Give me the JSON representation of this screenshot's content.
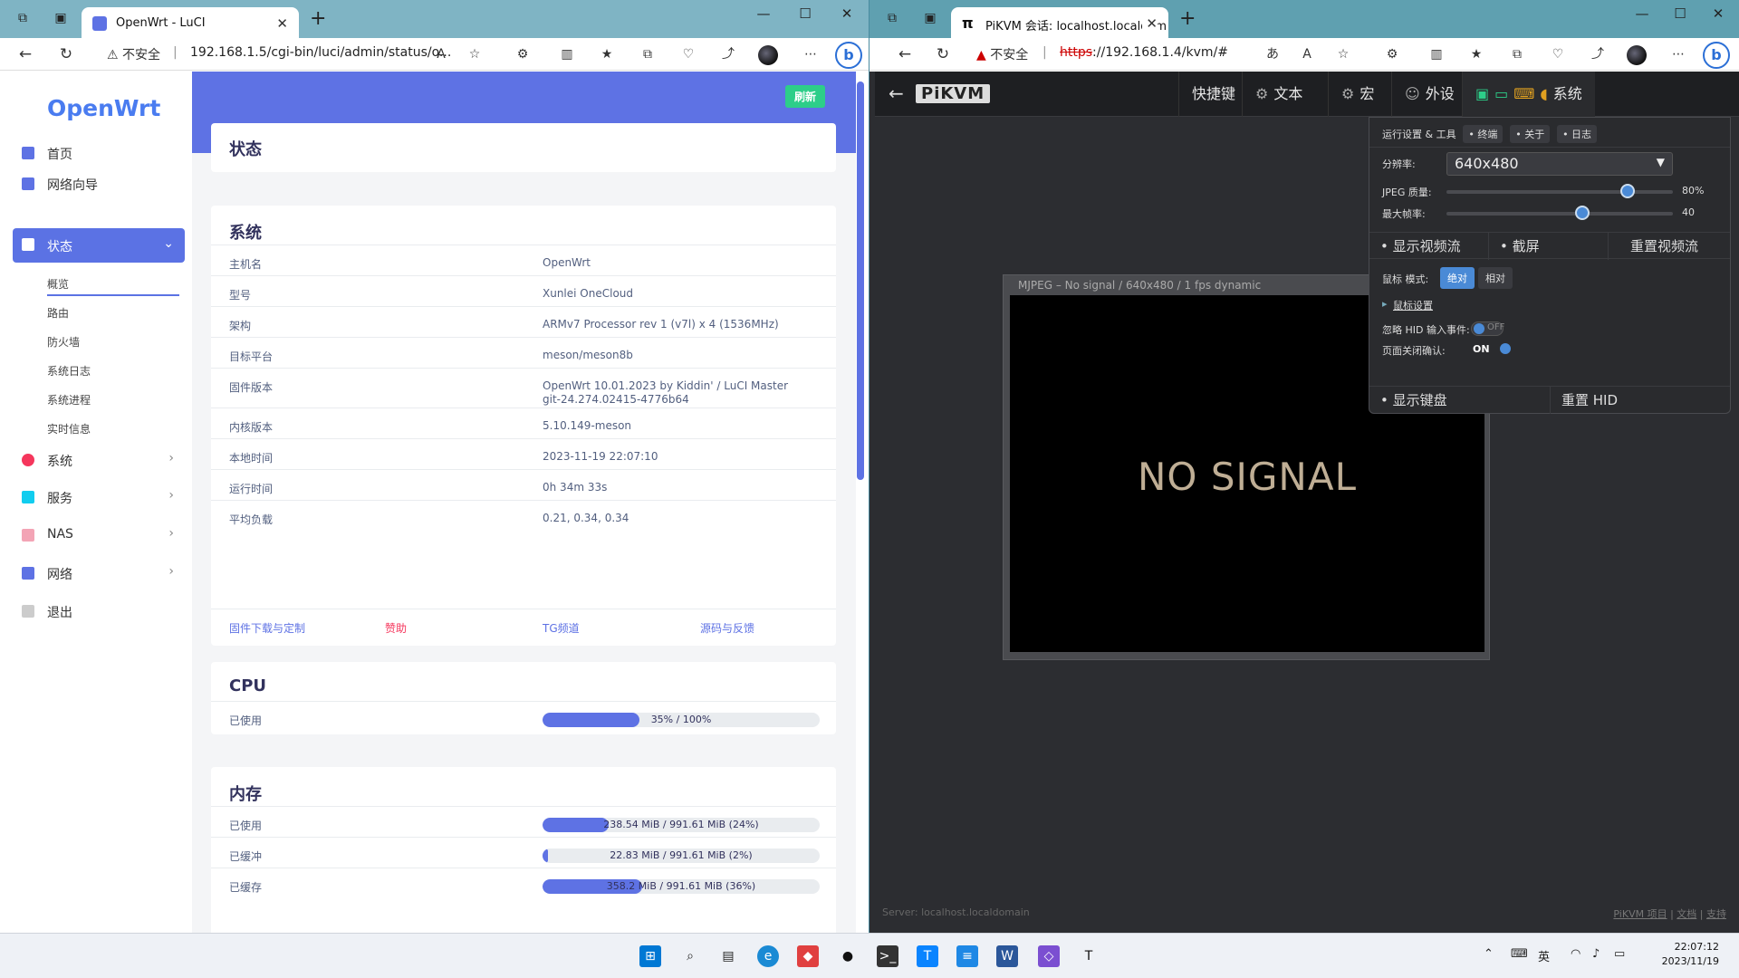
{
  "left_browser": {
    "tab_title": "OpenWrt - LuCI",
    "security": "不安全",
    "url": "192.168.1.5/cgi-bin/luci/admin/status/o...",
    "openwrt": {
      "logo": "OpenWrt",
      "refresh_label": "刷新",
      "nav": [
        {
          "label": "首页"
        },
        {
          "label": "网络向导"
        },
        {
          "label": "状态"
        }
      ],
      "subnav": [
        "概览",
        "路由",
        "防火墙",
        "系统日志",
        "系统进程",
        "实时信息"
      ],
      "nav2": [
        {
          "label": "系统"
        },
        {
          "label": "服务"
        },
        {
          "label": "NAS"
        },
        {
          "label": "网络"
        },
        {
          "label": "退出"
        }
      ],
      "page_title": "状态",
      "system": {
        "title": "系统",
        "rows": [
          {
            "k": "主机名",
            "v": "OpenWrt"
          },
          {
            "k": "型号",
            "v": "Xunlei OneCloud"
          },
          {
            "k": "架构",
            "v": "ARMv7 Processor rev 1 (v7l) x 4 (1536MHz)"
          },
          {
            "k": "目标平台",
            "v": "meson/meson8b"
          },
          {
            "k": "固件版本",
            "v": "OpenWrt 10.01.2023 by Kiddin' / LuCI Master git-24.274.02415-4776b64"
          },
          {
            "k": "内核版本",
            "v": "5.10.149-meson"
          },
          {
            "k": "本地时间",
            "v": "2023-11-19 22:07:10"
          },
          {
            "k": "运行时间",
            "v": "0h 34m 33s"
          },
          {
            "k": "平均负载",
            "v": "0.21, 0.34, 0.34"
          }
        ],
        "links": [
          "固件下载与定制",
          "赞助",
          "TG频道",
          "源码与反馈"
        ]
      },
      "cpu": {
        "title": "CPU",
        "label": "已使用",
        "text": "35% / 100%",
        "pct": 35
      },
      "memory": {
        "title": "内存",
        "rows": [
          {
            "k": "已使用",
            "text": "238.54 MiB / 991.61 MiB (24%)",
            "pct": 24
          },
          {
            "k": "已缓冲",
            "text": "22.83 MiB / 991.61 MiB (2%)",
            "pct": 2
          },
          {
            "k": "已缓存",
            "text": "358.2 MiB / 991.61 MiB (36%)",
            "pct": 36
          }
        ]
      }
    }
  },
  "right_browser": {
    "tab_title": "PiKVM 会话: localhost.localdom",
    "security": "不安全",
    "url_scheme": "https",
    "url_rest": "://192.168.1.4/kvm/#",
    "pikvm": {
      "logo": "PiKVM",
      "menu": [
        "快捷键",
        "文本",
        "宏",
        "外设",
        "系统"
      ],
      "panel": {
        "heading": "运行设置 & 工具",
        "pills": [
          "• 终端",
          "• 关于",
          "• 日志"
        ],
        "resolution_label": "分辨率:",
        "resolution": "640x480",
        "jpeg_label": "JPEG 质量:",
        "jpeg_value": "80%",
        "jpeg_pct": 80,
        "fps_label": "最大帧率:",
        "fps_value": "40",
        "fps_pct": 60,
        "buttons1": [
          "• 显示视频流",
          "• 截屏",
          "重置视频流"
        ],
        "mouse_mode_label": "鼠标 模式:",
        "mouse_abs": "绝对",
        "mouse_rel": "相对",
        "mouse_settings": "鼠标设置",
        "ignore_hid_label": "忽略 HID 输入事件:",
        "ignore_hid_state": "OFF",
        "page_close_label": "页面关闭确认:",
        "page_close_state": "ON",
        "buttons2": [
          "• 显示键盘",
          "重置 HID"
        ]
      },
      "video_title": "MJPEG – No signal / 640x480 / 1 fps dynamic",
      "no_signal": "NO SIGNAL",
      "server": "Server: localhost.localdomain",
      "footer_links": [
        "PiKVM 项目",
        "文档",
        "支持"
      ]
    }
  },
  "taskbar": {
    "lang": "英",
    "time": "22:07:12",
    "date": "2023/11/19"
  },
  "colors": {
    "accent": "#5e72e4",
    "success": "#2dce89",
    "pikvm_bg": "#2c2d31"
  }
}
